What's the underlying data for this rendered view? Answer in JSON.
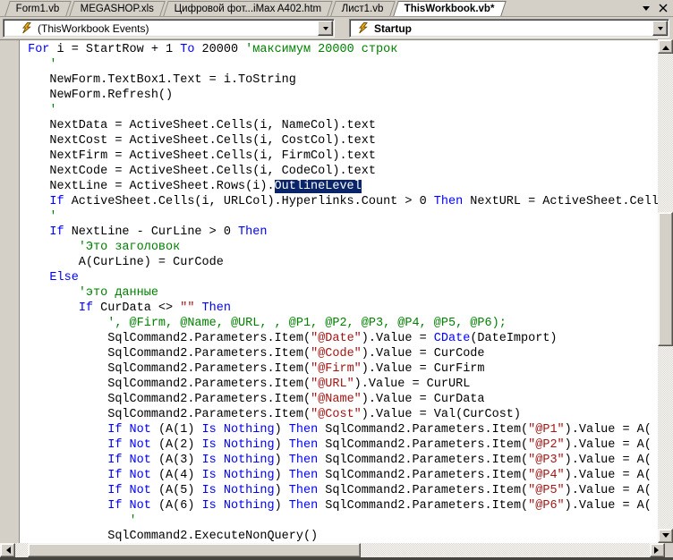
{
  "tab_bar": {
    "tabs": [
      {
        "label": "Form1.vb",
        "active": false
      },
      {
        "label": "MEGASHOP.xls",
        "active": false
      },
      {
        "label": "Цифровой фот...iMax A402.htm",
        "active": false
      },
      {
        "label": "Лист1.vb",
        "active": false
      },
      {
        "label": "ThisWorkbook.vb*",
        "active": true
      }
    ]
  },
  "toolbars": {
    "object_combo": {
      "value": "(ThisWorkbook Events)"
    },
    "procedure_combo": {
      "value": "Startup"
    }
  },
  "icons": {
    "tab_list": "chevron-down",
    "close": "x-cross",
    "combo_dropdown": "chevron-down",
    "combo_member": "lightning-bolt",
    "scroll_arrows": "triangle-up/down/left/right"
  },
  "colors": {
    "chrome": "#D4D0C8",
    "keyword": "#0000FF",
    "comment": "#008000",
    "string": "#A31515",
    "selection_bg": "#0A246A",
    "selection_fg": "#FFFFFF"
  },
  "code": {
    "lines": [
      [
        [
          "t",
          " "
        ],
        [
          "k",
          "For"
        ],
        [
          "t",
          " i = StartRow + 1 "
        ],
        [
          "k",
          "To"
        ],
        [
          "t",
          " 20000 "
        ],
        [
          "c",
          "'максимум 20000 строк"
        ]
      ],
      [
        [
          "t",
          "    "
        ],
        [
          "c",
          "'"
        ]
      ],
      [
        [
          "t",
          "    NewForm.TextBox1.Text = i.ToString"
        ]
      ],
      [
        [
          "t",
          "    NewForm.Refresh()"
        ]
      ],
      [
        [
          "t",
          "    "
        ],
        [
          "c",
          "'"
        ]
      ],
      [
        [
          "t",
          "    NextData = ActiveSheet.Cells(i, NameCol).text"
        ]
      ],
      [
        [
          "t",
          "    NextCost = ActiveSheet.Cells(i, CostCol).text"
        ]
      ],
      [
        [
          "t",
          "    NextFirm = ActiveSheet.Cells(i, FirmCol).text"
        ]
      ],
      [
        [
          "t",
          "    NextCode = ActiveSheet.Cells(i, CodeCol).text"
        ]
      ],
      [
        [
          "t",
          "    NextLine = ActiveSheet.Rows(i)."
        ],
        [
          "sel",
          "OutlineLevel"
        ]
      ],
      [
        [
          "t",
          "    "
        ],
        [
          "k",
          "If"
        ],
        [
          "t",
          " ActiveSheet.Cells(i, URLCol).Hyperlinks.Count > 0 "
        ],
        [
          "k",
          "Then"
        ],
        [
          "t",
          " NextURL = ActiveSheet.Cell"
        ]
      ],
      [
        [
          "t",
          "    "
        ],
        [
          "c",
          "'"
        ]
      ],
      [
        [
          "t",
          "    "
        ],
        [
          "k",
          "If"
        ],
        [
          "t",
          " NextLine - CurLine > 0 "
        ],
        [
          "k",
          "Then"
        ]
      ],
      [
        [
          "t",
          "        "
        ],
        [
          "c",
          "'Это заголовок"
        ]
      ],
      [
        [
          "t",
          "        A(CurLine) = CurCode"
        ]
      ],
      [
        [
          "t",
          "    "
        ],
        [
          "k",
          "Else"
        ]
      ],
      [
        [
          "t",
          "        "
        ],
        [
          "c",
          "'это данные"
        ]
      ],
      [
        [
          "t",
          "        "
        ],
        [
          "k",
          "If"
        ],
        [
          "t",
          " CurData <> "
        ],
        [
          "s",
          "\"\""
        ],
        [
          "t",
          " "
        ],
        [
          "k",
          "Then"
        ]
      ],
      [
        [
          "t",
          "            "
        ],
        [
          "c",
          "', @Firm, @Name, @URL, , @P1, @P2, @P3, @P4, @P5, @P6);"
        ]
      ],
      [
        [
          "t",
          "            SqlCommand2.Parameters.Item("
        ],
        [
          "s",
          "\"@Date\""
        ],
        [
          "t",
          ").Value = "
        ],
        [
          "k",
          "CDate"
        ],
        [
          "t",
          "(DateImport)"
        ]
      ],
      [
        [
          "t",
          "            SqlCommand2.Parameters.Item("
        ],
        [
          "s",
          "\"@Code\""
        ],
        [
          "t",
          ").Value = CurCode"
        ]
      ],
      [
        [
          "t",
          "            SqlCommand2.Parameters.Item("
        ],
        [
          "s",
          "\"@Firm\""
        ],
        [
          "t",
          ").Value = CurFirm"
        ]
      ],
      [
        [
          "t",
          "            SqlCommand2.Parameters.Item("
        ],
        [
          "s",
          "\"@URL\""
        ],
        [
          "t",
          ").Value = CurURL"
        ]
      ],
      [
        [
          "t",
          "            SqlCommand2.Parameters.Item("
        ],
        [
          "s",
          "\"@Name\""
        ],
        [
          "t",
          ").Value = CurData"
        ]
      ],
      [
        [
          "t",
          "            SqlCommand2.Parameters.Item("
        ],
        [
          "s",
          "\"@Cost\""
        ],
        [
          "t",
          ").Value = Val(CurCost)"
        ]
      ],
      [
        [
          "t",
          "            "
        ],
        [
          "k",
          "If"
        ],
        [
          "t",
          " "
        ],
        [
          "k",
          "Not"
        ],
        [
          "t",
          " (A(1) "
        ],
        [
          "k",
          "Is"
        ],
        [
          "t",
          " "
        ],
        [
          "k",
          "Nothing"
        ],
        [
          "t",
          ") "
        ],
        [
          "k",
          "Then"
        ],
        [
          "t",
          " SqlCommand2.Parameters.Item("
        ],
        [
          "s",
          "\"@P1\""
        ],
        [
          "t",
          ").Value = A("
        ]
      ],
      [
        [
          "t",
          "            "
        ],
        [
          "k",
          "If"
        ],
        [
          "t",
          " "
        ],
        [
          "k",
          "Not"
        ],
        [
          "t",
          " (A(2) "
        ],
        [
          "k",
          "Is"
        ],
        [
          "t",
          " "
        ],
        [
          "k",
          "Nothing"
        ],
        [
          "t",
          ") "
        ],
        [
          "k",
          "Then"
        ],
        [
          "t",
          " SqlCommand2.Parameters.Item("
        ],
        [
          "s",
          "\"@P2\""
        ],
        [
          "t",
          ").Value = A("
        ]
      ],
      [
        [
          "t",
          "            "
        ],
        [
          "k",
          "If"
        ],
        [
          "t",
          " "
        ],
        [
          "k",
          "Not"
        ],
        [
          "t",
          " (A(3) "
        ],
        [
          "k",
          "Is"
        ],
        [
          "t",
          " "
        ],
        [
          "k",
          "Nothing"
        ],
        [
          "t",
          ") "
        ],
        [
          "k",
          "Then"
        ],
        [
          "t",
          " SqlCommand2.Parameters.Item("
        ],
        [
          "s",
          "\"@P3\""
        ],
        [
          "t",
          ").Value = A("
        ]
      ],
      [
        [
          "t",
          "            "
        ],
        [
          "k",
          "If"
        ],
        [
          "t",
          " "
        ],
        [
          "k",
          "Not"
        ],
        [
          "t",
          " (A(4) "
        ],
        [
          "k",
          "Is"
        ],
        [
          "t",
          " "
        ],
        [
          "k",
          "Nothing"
        ],
        [
          "t",
          ") "
        ],
        [
          "k",
          "Then"
        ],
        [
          "t",
          " SqlCommand2.Parameters.Item("
        ],
        [
          "s",
          "\"@P4\""
        ],
        [
          "t",
          ").Value = A("
        ]
      ],
      [
        [
          "t",
          "            "
        ],
        [
          "k",
          "If"
        ],
        [
          "t",
          " "
        ],
        [
          "k",
          "Not"
        ],
        [
          "t",
          " (A(5) "
        ],
        [
          "k",
          "Is"
        ],
        [
          "t",
          " "
        ],
        [
          "k",
          "Nothing"
        ],
        [
          "t",
          ") "
        ],
        [
          "k",
          "Then"
        ],
        [
          "t",
          " SqlCommand2.Parameters.Item("
        ],
        [
          "s",
          "\"@P5\""
        ],
        [
          "t",
          ").Value = A("
        ]
      ],
      [
        [
          "t",
          "            "
        ],
        [
          "k",
          "If"
        ],
        [
          "t",
          " "
        ],
        [
          "k",
          "Not"
        ],
        [
          "t",
          " (A(6) "
        ],
        [
          "k",
          "Is"
        ],
        [
          "t",
          " "
        ],
        [
          "k",
          "Nothing"
        ],
        [
          "t",
          ") "
        ],
        [
          "k",
          "Then"
        ],
        [
          "t",
          " SqlCommand2.Parameters.Item("
        ],
        [
          "s",
          "\"@P6\""
        ],
        [
          "t",
          ").Value = A("
        ]
      ],
      [
        [
          "t",
          "               "
        ],
        [
          "c",
          "'"
        ]
      ],
      [
        [
          "t",
          "            SqlCommand2.ExecuteNonQuery()"
        ]
      ]
    ]
  }
}
